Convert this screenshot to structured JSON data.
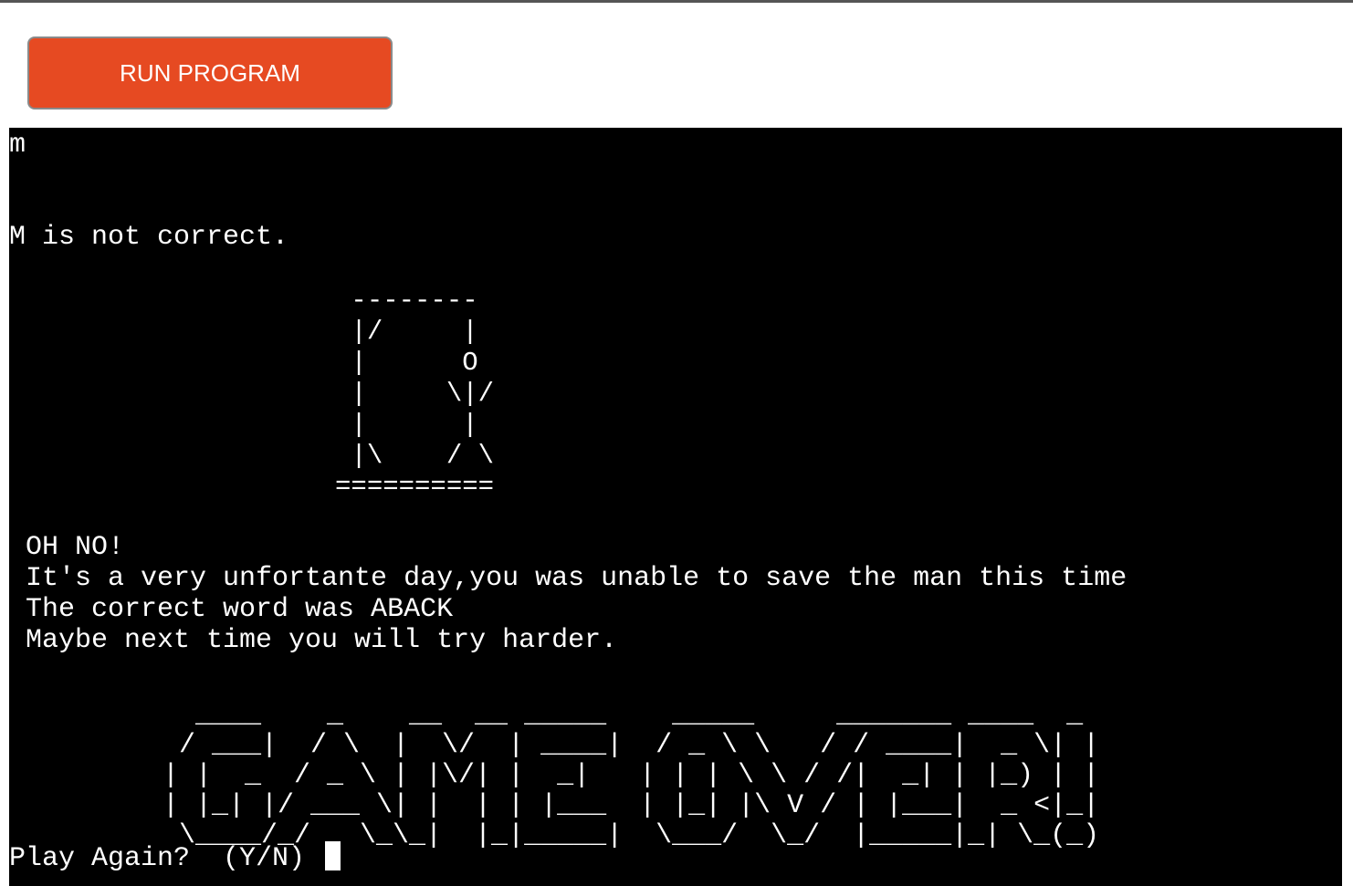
{
  "toolbar": {
    "run_label": "RUN PROGRAM",
    "run_color": "#e64a22"
  },
  "terminal": {
    "background": "#000000",
    "foreground": "#ffffff",
    "echo_input": "m",
    "feedback": "M is not correct.",
    "hangman_art": "      --------\n      |/     |\n      |      O\n      |     \\|/\n      |      |\n      |\\    / \\\n     ==========",
    "message_lines": [
      "OH NO!",
      "It's a very unfortante day,you was unable to save the man this time",
      "The correct word was ABACK",
      "Maybe next time you will try harder."
    ],
    "game_over_banner": "   ____    _    __  __ _____    _____     _______ ____  _ \n  / ___|  / \\  |  \\/  | ____|  / _ \\ \\   / / ____|  _ \\| |\n | |  _  / _ \\ | |\\/| |  _|   | | | \\ \\ / /|  _| | |_) | |\n | |_| |/ ___ \\| |  | | |___  | |_| |\\ V / | |___|  _ <|_|\n  \\____/_/   \\_\\_|  |_|_____|  \\___/  \\_/  |_____|_| \\_(_)",
    "prompt": "Play Again?  (Y/N) "
  }
}
